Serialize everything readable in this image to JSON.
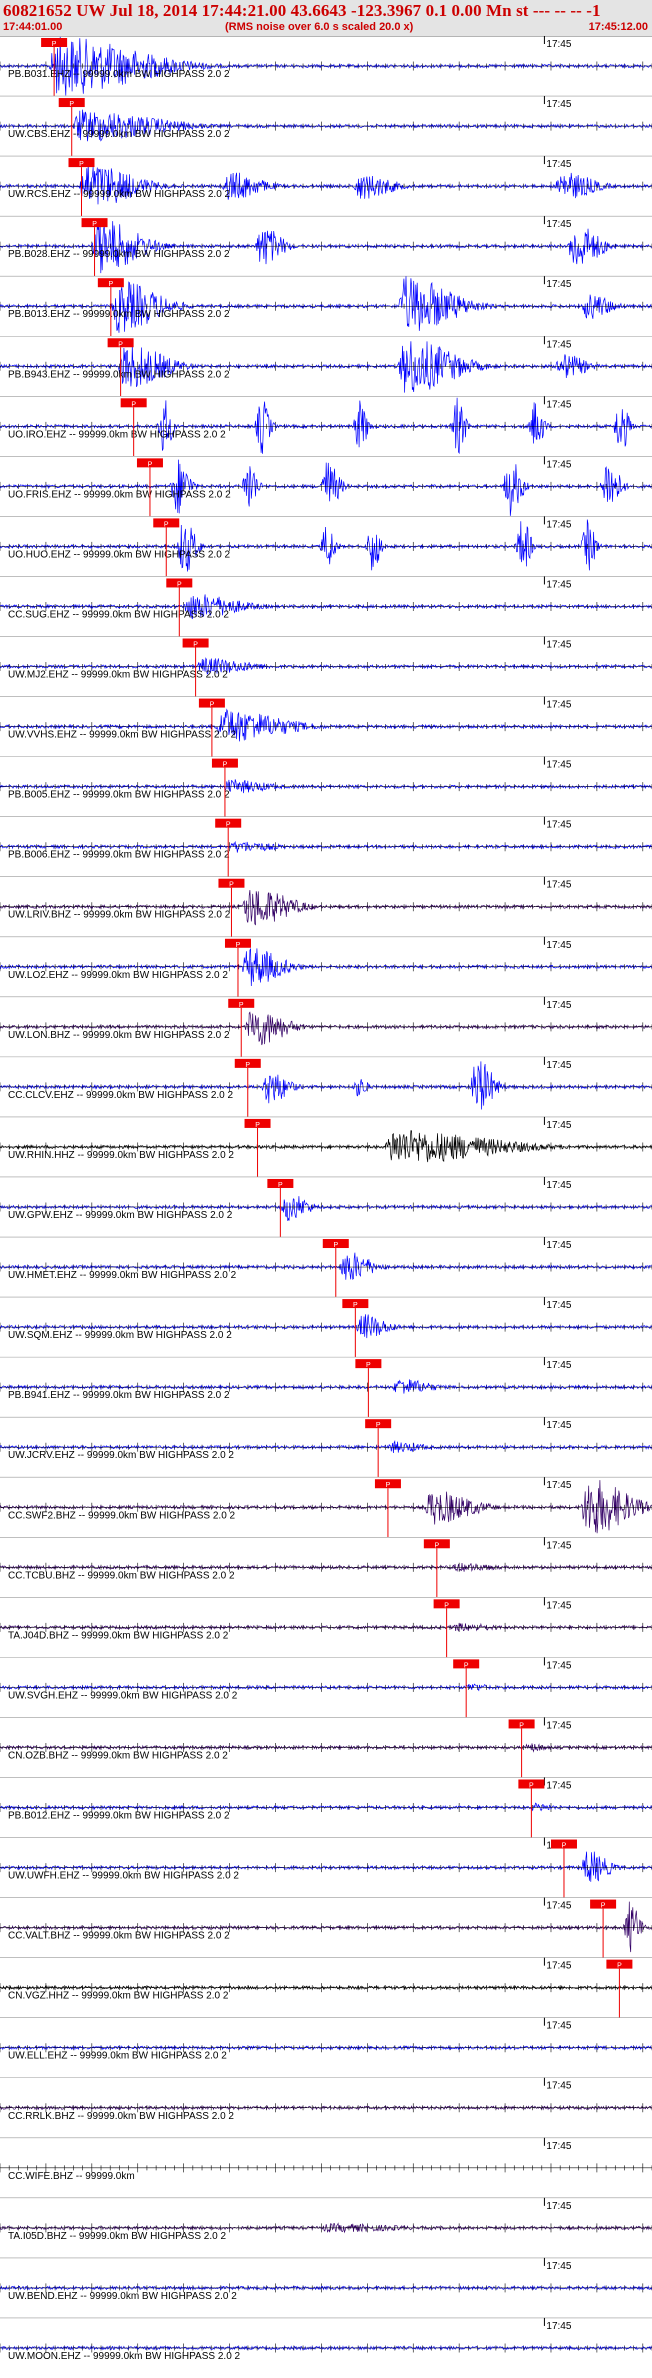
{
  "header": {
    "title": "60821652 UW Jul 18, 2014 17:44:21.00   43.6643 -123.3967  0.1 0.00 Mn st --- -- --  -1",
    "start_time": "17:44:01.00",
    "rms_note": "(RMS noise over 6.0 s scaled 20.0 x)",
    "end_time": "17:45:12.00"
  },
  "chart_data": {
    "type": "line",
    "title": "60821652 UW Jul 18, 2014 17:44:21.00   43.6643 -123.3967  0.1 0.00 Mn st --- -- --  -1",
    "x_range": [
      "17:44:01.00",
      "17:45:12.00"
    ],
    "minute_tick_label": "17:45",
    "pick_label": "P",
    "traces": [
      {
        "label": "PB.B031.EHZ -- 99999.0km BW  HIGHPASS  2.0  2",
        "color": "#0000ff",
        "pick": 0.083,
        "events": [
          [
            0.085,
            1.0,
            0.22
          ]
        ]
      },
      {
        "label": "UW.CBS.EHZ -- 99999.0km BW  HIGHPASS  2.0  2",
        "color": "#0000ff",
        "pick": 0.11,
        "events": [
          [
            0.12,
            0.55,
            0.2
          ]
        ]
      },
      {
        "label": "UW.RCS.EHZ -- 99999.0km BW  HIGHPASS  2.0  2",
        "color": "#0000ff",
        "pick": 0.125,
        "events": [
          [
            0.13,
            0.8,
            0.12
          ],
          [
            0.35,
            0.5,
            0.08
          ],
          [
            0.55,
            0.45,
            0.08
          ],
          [
            0.86,
            0.5,
            0.08
          ]
        ]
      },
      {
        "label": "PB.B028.EHZ -- 99999.0km BW  HIGHPASS  2.0  2",
        "color": "#0000ff",
        "pick": 0.145,
        "events": [
          [
            0.15,
            0.95,
            0.1
          ],
          [
            0.4,
            0.7,
            0.05
          ],
          [
            0.88,
            0.8,
            0.06
          ]
        ]
      },
      {
        "label": "PB.B013.EHZ -- 99999.0km BW  HIGHPASS  2.0  2",
        "color": "#0000ff",
        "pick": 0.17,
        "events": [
          [
            0.18,
            0.9,
            0.1
          ],
          [
            0.62,
            1.0,
            0.12
          ],
          [
            0.9,
            0.45,
            0.06
          ]
        ]
      },
      {
        "label": "PB.B943.EHZ -- 99999.0km BW  HIGHPASS  2.0  2",
        "color": "#0000ff",
        "pick": 0.185,
        "events": [
          [
            0.19,
            0.8,
            0.1
          ],
          [
            0.62,
            1.0,
            0.12
          ],
          [
            0.86,
            0.45,
            0.06
          ]
        ]
      },
      {
        "label": "UO.IRO.EHZ -- 99999.0km BW  HIGHPASS  2.0  2",
        "color": "#0000ff",
        "pick": 0.205,
        "events": [
          [
            0.25,
            1.0,
            0.02
          ],
          [
            0.4,
            1.0,
            0.02
          ],
          [
            0.55,
            0.9,
            0.02
          ],
          [
            0.7,
            1.0,
            0.02
          ],
          [
            0.82,
            0.9,
            0.02
          ],
          [
            0.95,
            1.0,
            0.02
          ]
        ]
      },
      {
        "label": "UO.FRIS.EHZ -- 99999.0km BW  HIGHPASS  2.0  2",
        "color": "#0000ff",
        "pick": 0.23,
        "events": [
          [
            0.27,
            1.0,
            0.03
          ],
          [
            0.38,
            1.0,
            0.02
          ],
          [
            0.5,
            0.9,
            0.03
          ],
          [
            0.78,
            1.0,
            0.03
          ],
          [
            0.93,
            1.0,
            0.03
          ]
        ]
      },
      {
        "label": "UO.HUO.EHZ -- 99999.0km BW  HIGHPASS  2.0  2",
        "color": "#0000ff",
        "pick": 0.255,
        "events": [
          [
            0.28,
            1.0,
            0.03
          ],
          [
            0.5,
            0.8,
            0.02
          ],
          [
            0.57,
            0.9,
            0.02
          ],
          [
            0.8,
            1.0,
            0.02
          ],
          [
            0.9,
            0.9,
            0.02
          ]
        ]
      },
      {
        "label": "CC.SUG.EHZ -- 99999.0km BW  HIGHPASS  2.0  2",
        "color": "#0000ff",
        "pick": 0.275,
        "events": [
          [
            0.29,
            0.45,
            0.12
          ]
        ]
      },
      {
        "label": "UW.MJ2.EHZ -- 99999.0km BW  HIGHPASS  2.0  2",
        "color": "#0000ff",
        "pick": 0.3,
        "events": [
          [
            0.31,
            0.3,
            0.12
          ]
        ]
      },
      {
        "label": "UW.VVHS.EHZ -- 99999.0km BW  HIGHPASS  2.0  2",
        "color": "#0000ff",
        "pick": 0.325,
        "events": [
          [
            0.34,
            0.6,
            0.15
          ]
        ]
      },
      {
        "label": "PB.B005.EHZ -- 99999.0km BW  HIGHPASS  2.0  2",
        "color": "#0000ff",
        "pick": 0.345,
        "events": [
          [
            0.35,
            0.25,
            0.1
          ]
        ]
      },
      {
        "label": "PB.B006.EHZ -- 99999.0km BW  HIGHPASS  2.0  2",
        "color": "#0000ff",
        "pick": 0.35,
        "events": [
          [
            0.36,
            0.2,
            0.1
          ]
        ]
      },
      {
        "label": "UW.LRIV.BHZ -- 99999.0km BW  HIGHPASS  2.0  2",
        "color": "#330066",
        "pick": 0.355,
        "events": [
          [
            0.38,
            0.7,
            0.1
          ]
        ]
      },
      {
        "label": "UW.LO2.EHZ -- 99999.0km BW  HIGHPASS  2.0  2",
        "color": "#0000ff",
        "pick": 0.365,
        "events": [
          [
            0.38,
            0.7,
            0.08
          ]
        ]
      },
      {
        "label": "UW.LON.BHZ -- 99999.0km BW  HIGHPASS  2.0  2",
        "color": "#330066",
        "pick": 0.37,
        "events": [
          [
            0.385,
            0.7,
            0.08
          ]
        ]
      },
      {
        "label": "CC.CLCV.EHZ -- 99999.0km BW  HIGHPASS  2.0  2",
        "color": "#0000ff",
        "pick": 0.38,
        "events": [
          [
            0.41,
            0.6,
            0.05
          ],
          [
            0.73,
            1.0,
            0.04
          ],
          [
            0.55,
            0.4,
            0.02
          ]
        ]
      },
      {
        "label": "UW.RHIN.HHZ -- 99999.0km BW  HIGHPASS  2.0  2",
        "color": "#000000",
        "pick": 0.395,
        "events": [
          [
            0.6,
            0.6,
            0.25
          ]
        ]
      },
      {
        "label": "UW.GPW.EHZ -- 99999.0km BW  HIGHPASS  2.0  2",
        "color": "#0000ff",
        "pick": 0.43,
        "events": [
          [
            0.44,
            0.5,
            0.05
          ]
        ]
      },
      {
        "label": "UW.HMET.EHZ -- 99999.0km BW  HIGHPASS  2.0  2",
        "color": "#0000ff",
        "pick": 0.515,
        "events": [
          [
            0.53,
            0.55,
            0.06
          ]
        ]
      },
      {
        "label": "UW.SQM.EHZ -- 99999.0km BW  HIGHPASS  2.0  2",
        "color": "#0000ff",
        "pick": 0.545,
        "events": [
          [
            0.555,
            0.45,
            0.06
          ]
        ]
      },
      {
        "label": "PB.B941.EHZ -- 99999.0km BW  HIGHPASS  2.0  2",
        "color": "#0000ff",
        "pick": 0.565,
        "events": [
          [
            0.61,
            0.3,
            0.08
          ]
        ]
      },
      {
        "label": "UW.JCRV.EHZ -- 99999.0km BW  HIGHPASS  2.0  2",
        "color": "#0000ff",
        "pick": 0.58,
        "events": [
          [
            0.6,
            0.2,
            0.08
          ]
        ]
      },
      {
        "label": "CC.SWF2.BHZ -- 99999.0km BW  HIGHPASS  2.0  2",
        "color": "#330066",
        "pick": 0.595,
        "events": [
          [
            0.66,
            0.6,
            0.1
          ],
          [
            0.9,
            1.0,
            0.1
          ]
        ]
      },
      {
        "label": "CC.TCBU.BHZ -- 99999.0km BW  HIGHPASS  2.0  2",
        "color": "#330066",
        "pick": 0.67,
        "events": [
          [
            0.7,
            0.15,
            0.1
          ]
        ]
      },
      {
        "label": "TA.J04D.BHZ -- 99999.0km BW  HIGHPASS  2.0  2",
        "color": "#330066",
        "pick": 0.685,
        "events": [
          [
            0.7,
            0.15,
            0.1
          ]
        ]
      },
      {
        "label": "UW.SVGH.EHZ -- 99999.0km BW  HIGHPASS  2.0  2",
        "color": "#0000ff",
        "pick": 0.715,
        "events": [
          [
            0.72,
            0.15,
            0.05
          ]
        ]
      },
      {
        "label": "CN.OZB.BHZ -- 99999.0km BW  HIGHPASS  2.0  2",
        "color": "#330066",
        "pick": 0.8,
        "events": [
          [
            0.81,
            0.15,
            0.05
          ]
        ]
      },
      {
        "label": "PB.B012.EHZ -- 99999.0km BW  HIGHPASS  2.0  2",
        "color": "#0000ff",
        "pick": 0.815,
        "events": [
          [
            0.82,
            0.15,
            0.05
          ]
        ]
      },
      {
        "label": "UW.UWFH.EHZ -- 99999.0km BW  HIGHPASS  2.0  2",
        "color": "#0000ff",
        "pick": 0.865,
        "events": [
          [
            0.9,
            0.6,
            0.05
          ]
        ]
      },
      {
        "label": "CC.VALT.BHZ -- 99999.0km BW  HIGHPASS  2.0  2",
        "color": "#330066",
        "pick": 0.925,
        "events": [
          [
            0.965,
            0.9,
            0.025
          ]
        ]
      },
      {
        "label": "CN.VGZ.HHZ -- 99999.0km BW  HIGHPASS  2.0  2",
        "color": "#000000",
        "pick": 0.95,
        "events": []
      },
      {
        "label": "UW.ELL.EHZ -- 99999.0km BW  HIGHPASS  2.0  2",
        "color": "#0000ff",
        "pick": null,
        "events": []
      },
      {
        "label": "CC.RRLK.BHZ -- 99999.0km BW  HIGHPASS  2.0  2",
        "color": "#330066",
        "pick": null,
        "events": []
      },
      {
        "label": "CC.WIFE.BHZ -- 99999.0km",
        "color": "#330066",
        "pick": null,
        "events": [],
        "empty": true
      },
      {
        "label": "TA.I05D.BHZ -- 99999.0km BW  HIGHPASS  2.0  2",
        "color": "#330066",
        "pick": null,
        "events": [
          [
            0.5,
            0.15,
            0.2
          ]
        ]
      },
      {
        "label": "UW.BEND.EHZ -- 99999.0km BW  HIGHPASS  2.0  2",
        "color": "#0000ff",
        "pick": null,
        "events": []
      },
      {
        "label": "UW.MOON.EHZ -- 99999.0km BW  HIGHPASS  2.0  2",
        "color": "#0000ff",
        "pick": null,
        "events": []
      }
    ]
  }
}
